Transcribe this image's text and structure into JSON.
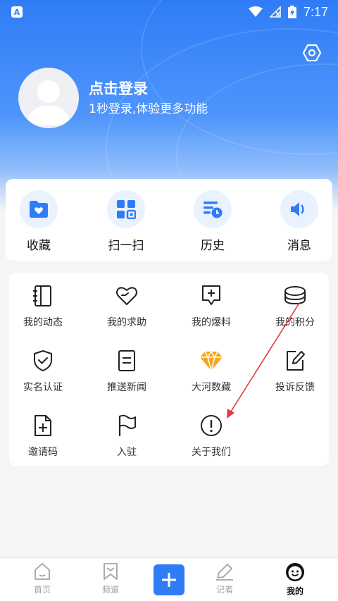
{
  "status_bar": {
    "time": "7:17",
    "app_badge": "A"
  },
  "profile": {
    "title": "点击登录",
    "subtitle": "1秒登录,体验更多功能"
  },
  "quick_actions": [
    {
      "label": "收藏",
      "icon": "folder-heart-icon"
    },
    {
      "label": "扫一扫",
      "icon": "scan-icon"
    },
    {
      "label": "历史",
      "icon": "history-icon"
    },
    {
      "label": "消息",
      "icon": "speaker-icon"
    }
  ],
  "grid": [
    {
      "label": "我的动态",
      "icon": "notebook-icon"
    },
    {
      "label": "我的求助",
      "icon": "heart-hand-icon"
    },
    {
      "label": "我的爆料",
      "icon": "message-plus-icon"
    },
    {
      "label": "我的积分",
      "icon": "coins-icon"
    },
    {
      "label": "实名认证",
      "icon": "shield-check-icon"
    },
    {
      "label": "推送新闻",
      "icon": "document-icon"
    },
    {
      "label": "大河数藏",
      "icon": "diamond-icon"
    },
    {
      "label": "投诉反馈",
      "icon": "edit-square-icon"
    },
    {
      "label": "邀请码",
      "icon": "file-plus-icon"
    },
    {
      "label": "入驻",
      "icon": "flag-icon"
    },
    {
      "label": "关于我们",
      "icon": "info-circle-icon"
    }
  ],
  "tabs": [
    {
      "label": "首页",
      "icon": "home-icon"
    },
    {
      "label": "频道",
      "icon": "bookmark-icon"
    },
    {
      "label": "",
      "icon": "plus-icon"
    },
    {
      "label": "记者",
      "icon": "pen-icon"
    },
    {
      "label": "我的",
      "icon": "smiley-icon",
      "active": true
    }
  ],
  "colors": {
    "accent": "#2f7cf6",
    "annotation": "#e53935",
    "diamond": "#f5a623"
  }
}
